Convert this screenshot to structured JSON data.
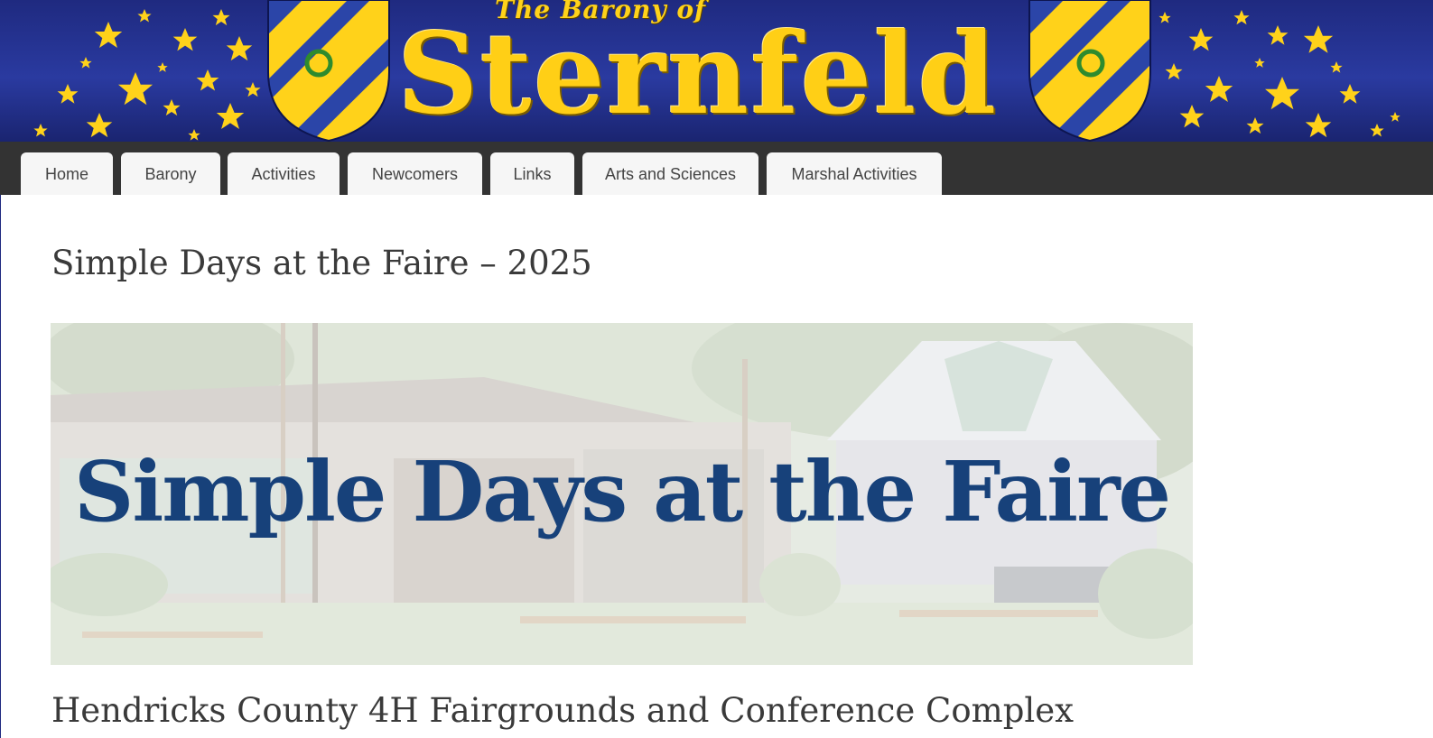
{
  "banner": {
    "pretitle": "The Barony of",
    "site_name": "Sternfeld",
    "colors": {
      "background": "#1f2a80",
      "gold": "#ffcf16",
      "shield_blue": "#2b45a8",
      "laurel": "#2e8b2e"
    }
  },
  "nav": {
    "items": [
      {
        "label": "Home"
      },
      {
        "label": "Barony"
      },
      {
        "label": "Activities"
      },
      {
        "label": "Newcomers"
      },
      {
        "label": "Links"
      },
      {
        "label": "Arts and Sciences"
      },
      {
        "label": "Marshal Activities"
      }
    ]
  },
  "page": {
    "title": "Simple Days at the Faire – 2025",
    "hero_text": "Simple Days at the Faire",
    "subtitle": "Hendricks County 4H Fairgrounds and Conference Complex"
  }
}
